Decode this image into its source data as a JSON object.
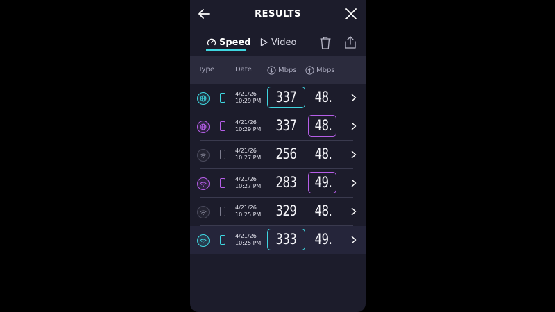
{
  "header": {
    "title": "RESULTS"
  },
  "tabs": [
    {
      "label": "Speed",
      "active": true
    },
    {
      "label": "Video",
      "active": false
    }
  ],
  "columns": {
    "type": "Type",
    "date": "Date",
    "download": "Mbps",
    "upload": "Mbps"
  },
  "colors": {
    "teal": "#3fd6e0",
    "purple": "#b65ee8",
    "background": "#1c1c2b",
    "header_band": "#2b2b3d"
  },
  "rows": [
    {
      "icon": "globe-icon",
      "icon_color": "teal",
      "device_color": "teal",
      "date": "4/21/26",
      "time": "10:29 PM",
      "download": "337",
      "upload": "48.",
      "highlight": "download",
      "highlight_color": "teal"
    },
    {
      "icon": "globe-icon",
      "icon_color": "purple",
      "device_color": "purple",
      "date": "4/21/26",
      "time": "10:29 PM",
      "download": "337",
      "upload": "48.",
      "highlight": "upload",
      "highlight_color": "purple"
    },
    {
      "icon": "wifi-icon",
      "icon_color": "gray",
      "device_color": "gray",
      "date": "4/21/26",
      "time": "10:27 PM",
      "download": "256",
      "upload": "48.",
      "highlight": "none",
      "highlight_color": ""
    },
    {
      "icon": "wifi-icon",
      "icon_color": "purple",
      "device_color": "purple",
      "date": "4/21/26",
      "time": "10:27 PM",
      "download": "283",
      "upload": "49.",
      "highlight": "upload",
      "highlight_color": "purple"
    },
    {
      "icon": "wifi-icon",
      "icon_color": "gray",
      "device_color": "gray",
      "date": "4/21/26",
      "time": "10:25 PM",
      "download": "329",
      "upload": "48.",
      "highlight": "none",
      "highlight_color": ""
    },
    {
      "icon": "wifi-icon",
      "icon_color": "teal",
      "device_color": "teal",
      "date": "4/21/26",
      "time": "10:25 PM",
      "download": "333",
      "upload": "49.",
      "highlight": "download",
      "highlight_color": "teal"
    }
  ]
}
